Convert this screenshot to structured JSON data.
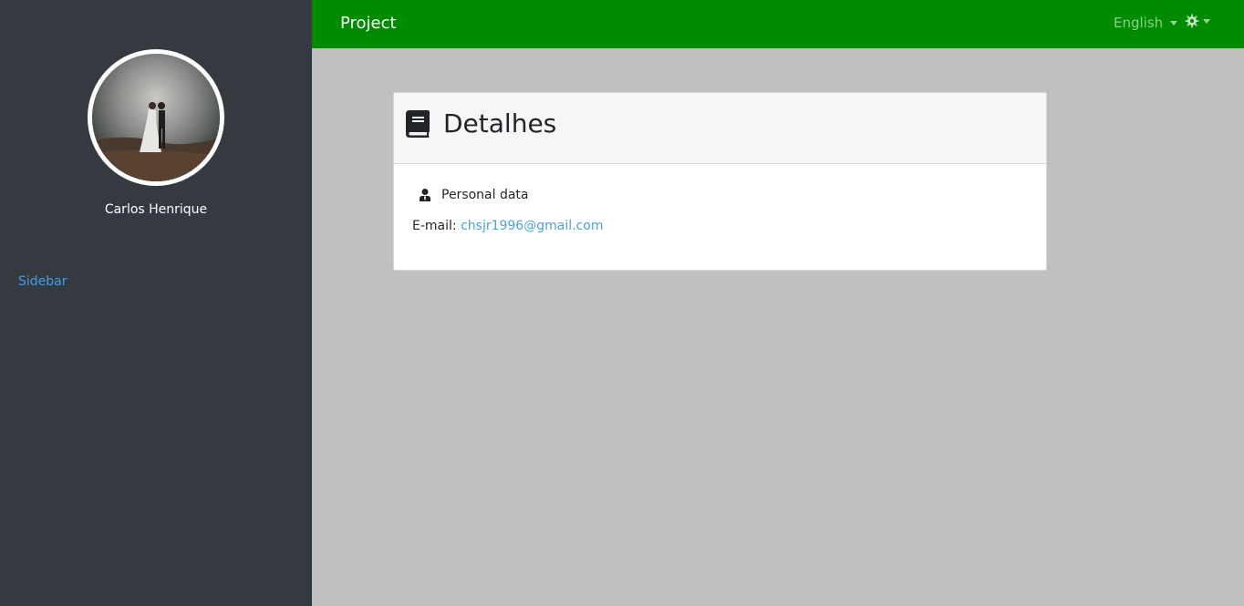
{
  "navbar": {
    "brand": "Project",
    "language": "English",
    "settings_icon": "gear-icon",
    "background": "#008c00"
  },
  "sidebar": {
    "user_name": "Carlos Henrique",
    "link_label": "Sidebar",
    "background": "#343a40"
  },
  "card": {
    "header_icon": "book-icon",
    "title": "Detalhes",
    "section_icon": "user-tie-icon",
    "section_label": "Personal data",
    "email_label": "E-mail:",
    "email_value": "chsjr1996@gmail.com"
  }
}
